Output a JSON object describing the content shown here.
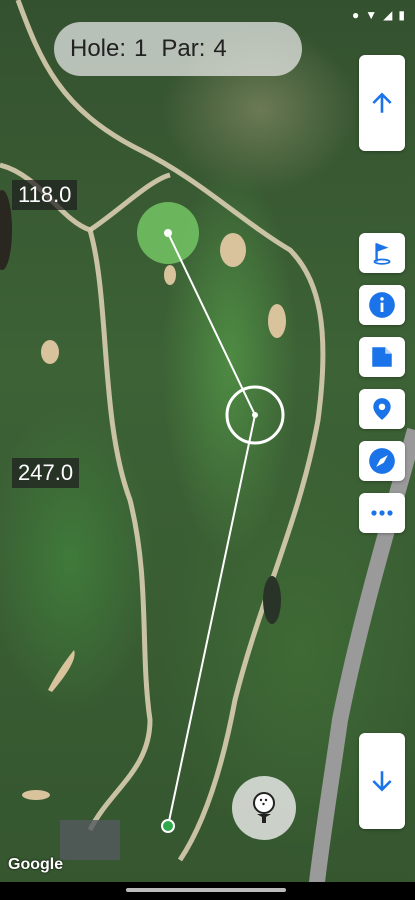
{
  "header": {
    "hole_label": "Hole:",
    "hole_value": "1",
    "par_label": "Par:",
    "par_value": "4"
  },
  "distances": {
    "top": "118.0",
    "bottom": "247.0"
  },
  "buttons": {
    "scroll_up": "arrow-up-icon",
    "flag": "flag-icon",
    "info": "info-icon",
    "notes": "note-icon",
    "location": "location-pin-icon",
    "compass": "compass-icon",
    "more": "more-icon",
    "scroll_down": "arrow-down-icon",
    "ball": "golf-ball-tee-icon"
  },
  "map": {
    "attribution": "Google"
  },
  "colors": {
    "accent": "#1a73e8",
    "target_line": "#ffffff",
    "green_circle": "#7cd36b"
  }
}
